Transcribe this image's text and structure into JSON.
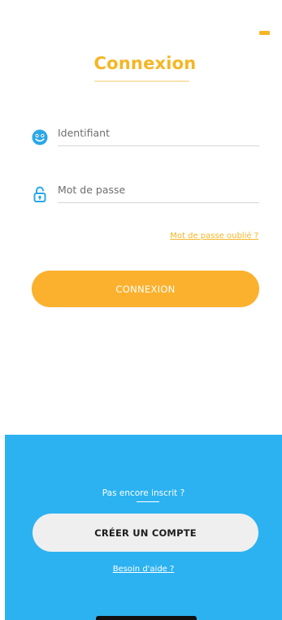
{
  "header": {
    "title": "Connexion"
  },
  "form": {
    "identifiant": {
      "placeholder": "Identifiant",
      "icon": "smiley-face-icon"
    },
    "password": {
      "placeholder": "Mot de passe",
      "icon": "padlock-icon"
    },
    "forgot_link": "Mot de passe oublié ?",
    "login_button": "CONNEXION"
  },
  "footer": {
    "not_registered": "Pas encore inscrit ?",
    "create_account_button": "CRÉER UN COMPTE",
    "help_link": "Besoin d'aide ?"
  },
  "colors": {
    "accent_yellow": "#f5b625",
    "button_yellow": "#fbb12d",
    "footer_blue": "#2cb2f1",
    "icon_blue": "#2aa8e8"
  }
}
